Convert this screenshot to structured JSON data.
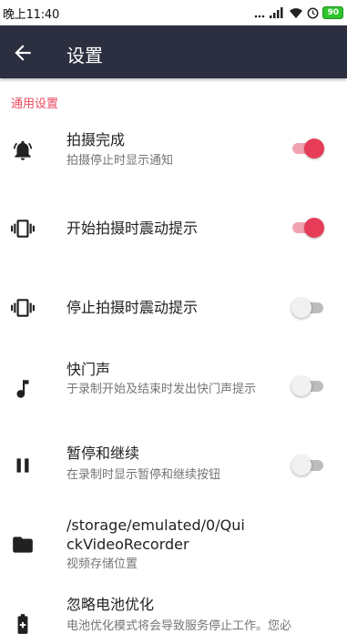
{
  "status_bar": {
    "time": "晚上11:40",
    "battery": "90"
  },
  "app_bar": {
    "title": "设置"
  },
  "section_header": "通用设置",
  "colors": {
    "accent": "#e63c58",
    "app_bar": "#2b2f3f",
    "section": "#e8475f"
  },
  "settings": [
    {
      "icon": "bell-ringing-icon",
      "title": "拍摄完成",
      "summary": "拍摄停止时显示通知",
      "switch": true
    },
    {
      "icon": "vibrate-icon",
      "title": "开始拍摄时震动提示",
      "summary": "",
      "switch": true
    },
    {
      "icon": "vibrate-icon",
      "title": "停止拍摄时震动提示",
      "summary": "",
      "switch": false
    },
    {
      "icon": "music-note-icon",
      "title": "快门声",
      "summary": "于录制开始及结束时发出快门声提示",
      "switch": false
    },
    {
      "icon": "pause-icon",
      "title": "暂停和继续",
      "summary": "在录制时显示暂停和继续按钮",
      "switch": false
    },
    {
      "icon": "folder-icon",
      "title": "/storage/emulated/0/QuickVideoRecorder",
      "summary": "视频存储位置"
    },
    {
      "icon": "battery-plus-icon",
      "title": "忽略电池优化",
      "summary": "电池优化模式将会导致服务停止工作。您必"
    }
  ]
}
